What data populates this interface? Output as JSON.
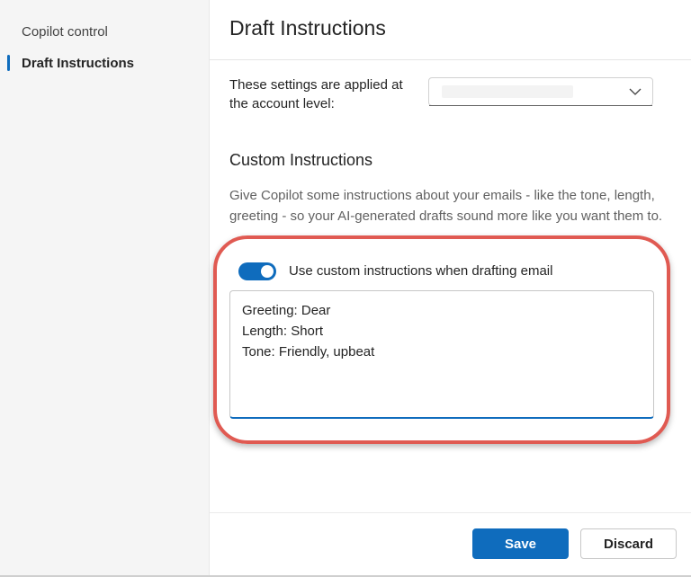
{
  "sidebar": {
    "items": [
      {
        "label": "Copilot control",
        "active": false
      },
      {
        "label": "Draft Instructions",
        "active": true
      }
    ]
  },
  "header": {
    "title": "Draft Instructions"
  },
  "account": {
    "label": "These settings are applied at the account level:",
    "selected_value": "",
    "icon": "chevron-down-icon"
  },
  "custom_instructions": {
    "heading": "Custom Instructions",
    "description": "Give Copilot some instructions about your emails - like the tone, length, greeting - so your AI-generated drafts sound more like you want them to.",
    "toggle": {
      "label": "Use custom instructions when drafting email",
      "on": true
    },
    "instructions_text": "Greeting: Dear\nLength: Short\nTone: Friendly, upbeat"
  },
  "footer": {
    "save_label": "Save",
    "discard_label": "Discard"
  },
  "colors": {
    "accent": "#0f6cbd",
    "highlight": "#e05a52",
    "sidebar_bg": "#f5f5f5"
  }
}
